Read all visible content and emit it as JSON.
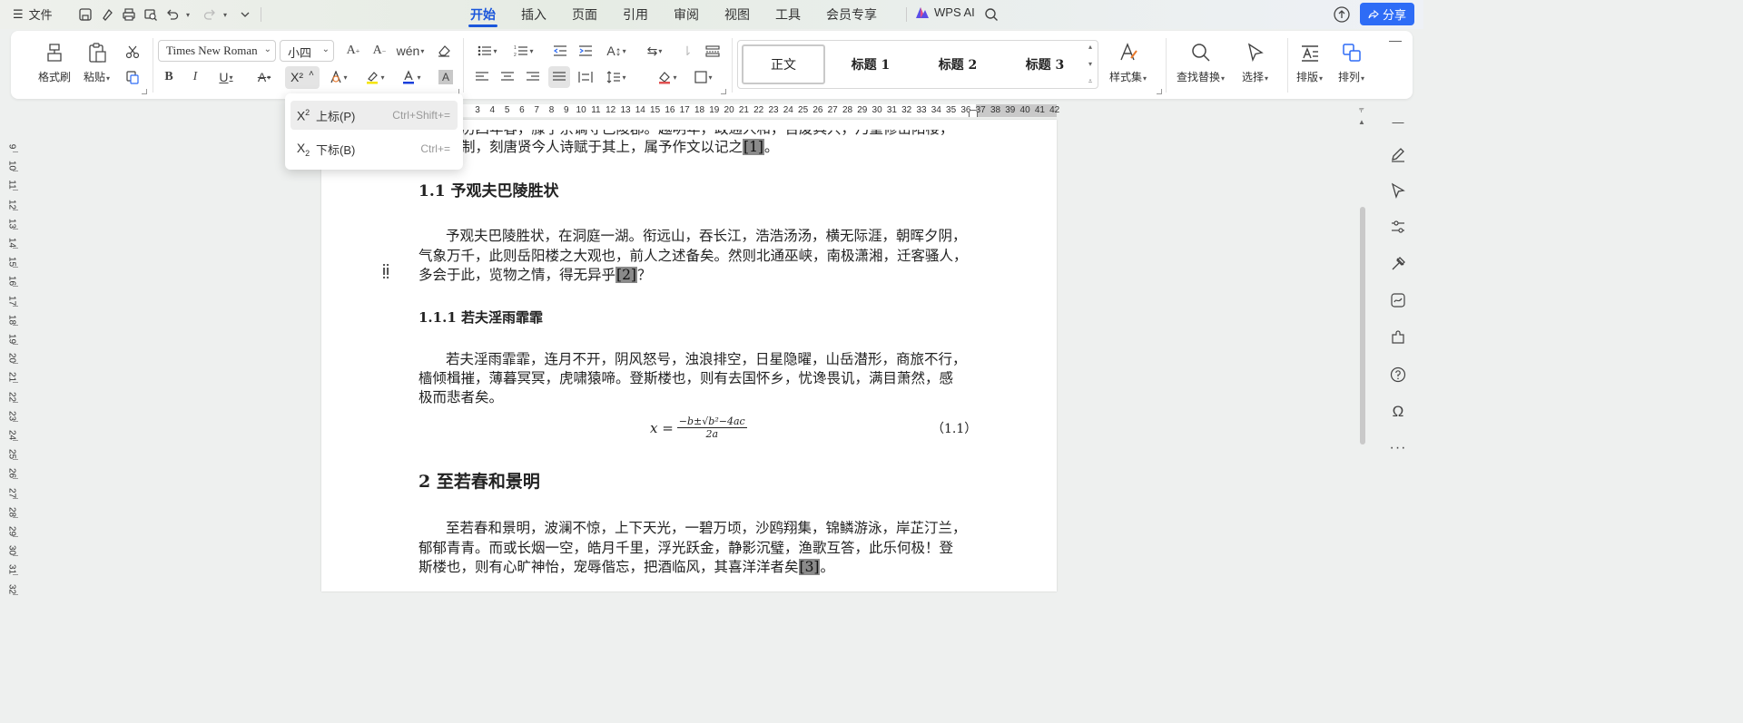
{
  "topbar": {
    "file_label": "文件",
    "tabs": [
      "开始",
      "插入",
      "页面",
      "引用",
      "审阅",
      "视图",
      "工具",
      "会员专享"
    ],
    "active_tab": "开始",
    "wps_ai_label": "WPS AI",
    "share_label": "分享"
  },
  "ribbon": {
    "format_painter": "格式刷",
    "paste": "粘贴",
    "font_name": "Times New Roman",
    "font_size": "小四",
    "superscript_btn": "X²",
    "styles": [
      "正文",
      "标题  1",
      "标题  2",
      "标题  3"
    ],
    "style_set": "样式集",
    "find_replace": "查找替换",
    "select": "选择",
    "layout": "排版",
    "arrange": "排列"
  },
  "superscript_menu": {
    "items": [
      {
        "glyph": "X",
        "mark": "2",
        "label": "上标(P)",
        "shortcut": "Ctrl+Shift+="
      },
      {
        "glyph": "X",
        "mark": "2",
        "label": "下标(B)",
        "shortcut": "Ctrl+="
      }
    ]
  },
  "ruler": {
    "top_numbers": [
      "3",
      "4",
      "5",
      "6",
      "7",
      "8",
      "9",
      "10",
      "11",
      "12",
      "13",
      "14",
      "15",
      "16",
      "17",
      "18",
      "19",
      "20",
      "21",
      "22",
      "23",
      "24",
      "25",
      "26",
      "27",
      "28",
      "29",
      "30",
      "31",
      "32",
      "33",
      "34",
      "35",
      "36",
      "37",
      "38",
      "39",
      "40",
      "41",
      "42"
    ],
    "left_numbers": [
      "9",
      "10",
      "11",
      "12",
      "13",
      "14",
      "15",
      "16",
      "17",
      "18",
      "19",
      "20",
      "21",
      "22",
      "23",
      "24",
      "25",
      "26",
      "27",
      "28",
      "29",
      "30",
      "31",
      "32"
    ]
  },
  "document": {
    "line_top_a": "历四年春，滕子京谪守巴陵郡。越明年，政通人和，百废具兴，乃重修岳阳楼，",
    "line_top_b_pre": "制，刻唐贤今人诗赋于其上，属予作文以记之",
    "cite1": "[1]",
    "line_top_b_post": "。",
    "h_1_1": "1.1 予观夫巴陵胜状",
    "p1_l1": "予观夫巴陵胜状，在洞庭一湖。衔远山，吞长江，浩浩汤汤，横无际涯，朝晖夕阴，",
    "p1_l2": "气象万千，此则岳阳楼之大观也，前人之述备矣。然则北通巫峡，南极潇湘，迁客骚人，",
    "p1_l3_pre": "多会于此，览物之情，得无异乎",
    "cite2": "[2]",
    "p1_l3_post": "？",
    "h_1_1_1": "1.1.1 若夫淫雨霏霏",
    "p2_l1": "若夫淫雨霏霏，连月不开，阴风怒号，浊浪排空，日星隐曜，山岳潜形，商旅不行，",
    "p2_l2": "樯倾楫摧，薄暮冥冥，虎啸猿啼。登斯楼也，则有去国怀乡，忧谗畏讥，满目萧然，感",
    "p2_l3": "极而悲者矣。",
    "eq_lhs": "x =",
    "eq_num": "−b±√b²−4ac",
    "eq_den": "2a",
    "eq_label": "（1.1）",
    "h_2": "2 至若春和景明",
    "p3_l1": "至若春和景明，波澜不惊，上下天光，一碧万顷，沙鸥翔集，锦鳞游泳，岸芷汀兰，",
    "p3_l2": "郁郁青青。而或长烟一空，皓月千里，浮光跃金，静影沉璧，渔歌互答，此乐何极！登",
    "p3_l3_pre": "斯楼也，则有心旷神怡，宠辱偕忘，把酒临风，其喜洋洋者矣",
    "cite3": "[3]",
    "p3_l3_post": "。"
  },
  "colors": {
    "accent": "#1a56db",
    "share_bg": "#2e6cf6",
    "cite_bg": "#8a8a8a"
  }
}
